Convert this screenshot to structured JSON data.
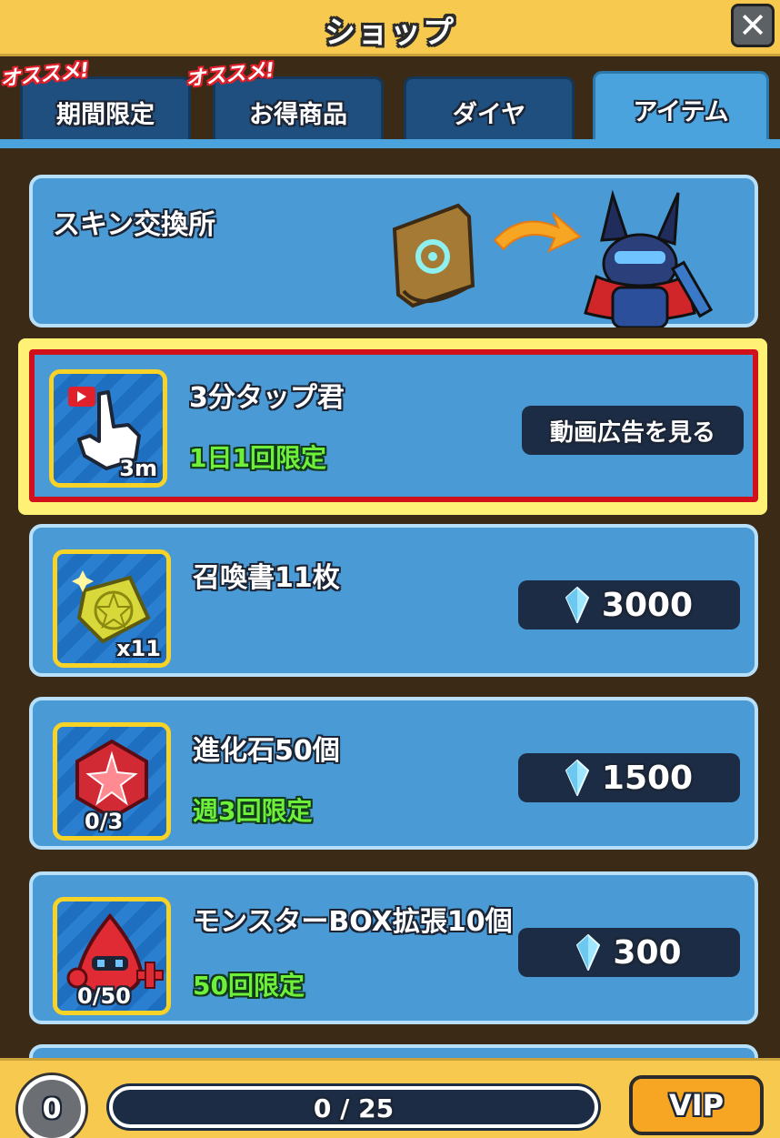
{
  "header": {
    "title": "ショップ"
  },
  "tabs": [
    {
      "label": "期間限定",
      "badge": "オススメ!"
    },
    {
      "label": "お得商品",
      "badge": "オススメ!"
    },
    {
      "label": "ダイヤ"
    },
    {
      "label": "アイテム",
      "active": true
    }
  ],
  "skin_exchange": {
    "title": "スキン交換所"
  },
  "items": [
    {
      "title": "3分タップ君",
      "limit": "1日1回限定",
      "icon_count": "3m",
      "action": "動画広告を見る",
      "icon": "tap-hand-icon"
    },
    {
      "title": "召喚書11枚",
      "limit": "",
      "icon_count": "x11",
      "price": "3000",
      "icon": "summon-book-icon"
    },
    {
      "title": "進化石50個",
      "limit": "週3回限定",
      "icon_count": "0/3",
      "price": "1500",
      "icon": "evolution-stone-icon"
    },
    {
      "title": "モンスターBOX拡張10個",
      "limit": "50回限定",
      "icon_count": "0/50",
      "price": "300",
      "icon": "monster-box-icon"
    }
  ],
  "footer": {
    "level": "0",
    "progress_text": "0 / 25",
    "progress_fraction": 0,
    "vip_label": "VIP"
  },
  "colors": {
    "header": "#f7c94e",
    "card": "#4a9ad6",
    "highlight_outer": "#fff176",
    "highlight_inner": "#d0101a",
    "limit_text": "#6ef03b"
  }
}
